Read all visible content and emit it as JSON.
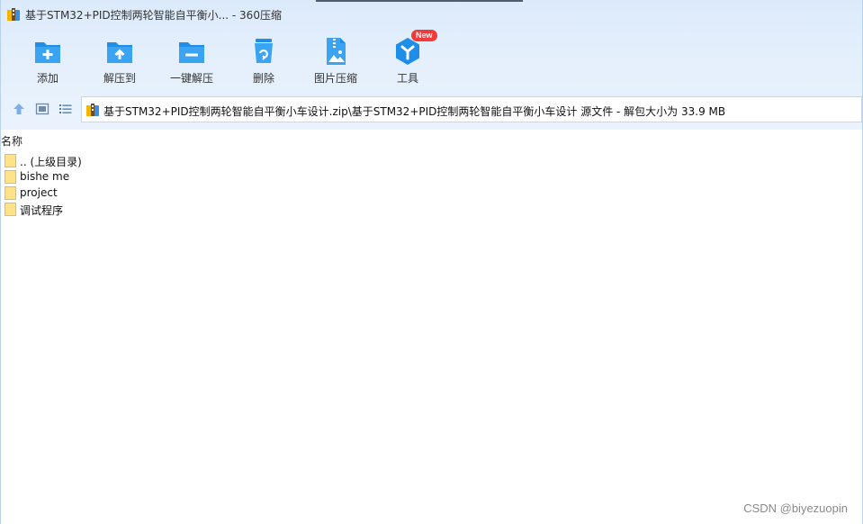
{
  "window": {
    "title": "基于STM32+PID控制两轮智能自平衡小... - 360压缩"
  },
  "toolbar": {
    "items": [
      {
        "label": "添加",
        "icon": "add-icon"
      },
      {
        "label": "解压到",
        "icon": "extract-to-icon"
      },
      {
        "label": "一键解压",
        "icon": "one-click-extract-icon"
      },
      {
        "label": "删除",
        "icon": "delete-icon"
      },
      {
        "label": "图片压缩",
        "icon": "image-compress-icon"
      },
      {
        "label": "工具",
        "icon": "tools-icon"
      }
    ],
    "new_badge": "New"
  },
  "address": {
    "path": "基于STM32+PID控制两轮智能自平衡小车设计.zip\\基于STM32+PID控制两轮智能自平衡小车设计 源文件 - 解包大小为 33.9 MB"
  },
  "list": {
    "column_name": "名称",
    "items": [
      {
        "name": ".. (上级目录)"
      },
      {
        "name": "bishe me"
      },
      {
        "name": "project"
      },
      {
        "name": "调试程序"
      }
    ]
  },
  "watermark": "CSDN @biyezuopin",
  "colors": {
    "accent": "#1e8ee8",
    "header_bg": "#dbeafb",
    "folder": "#ffe28a",
    "badge": "#f23a3a"
  }
}
